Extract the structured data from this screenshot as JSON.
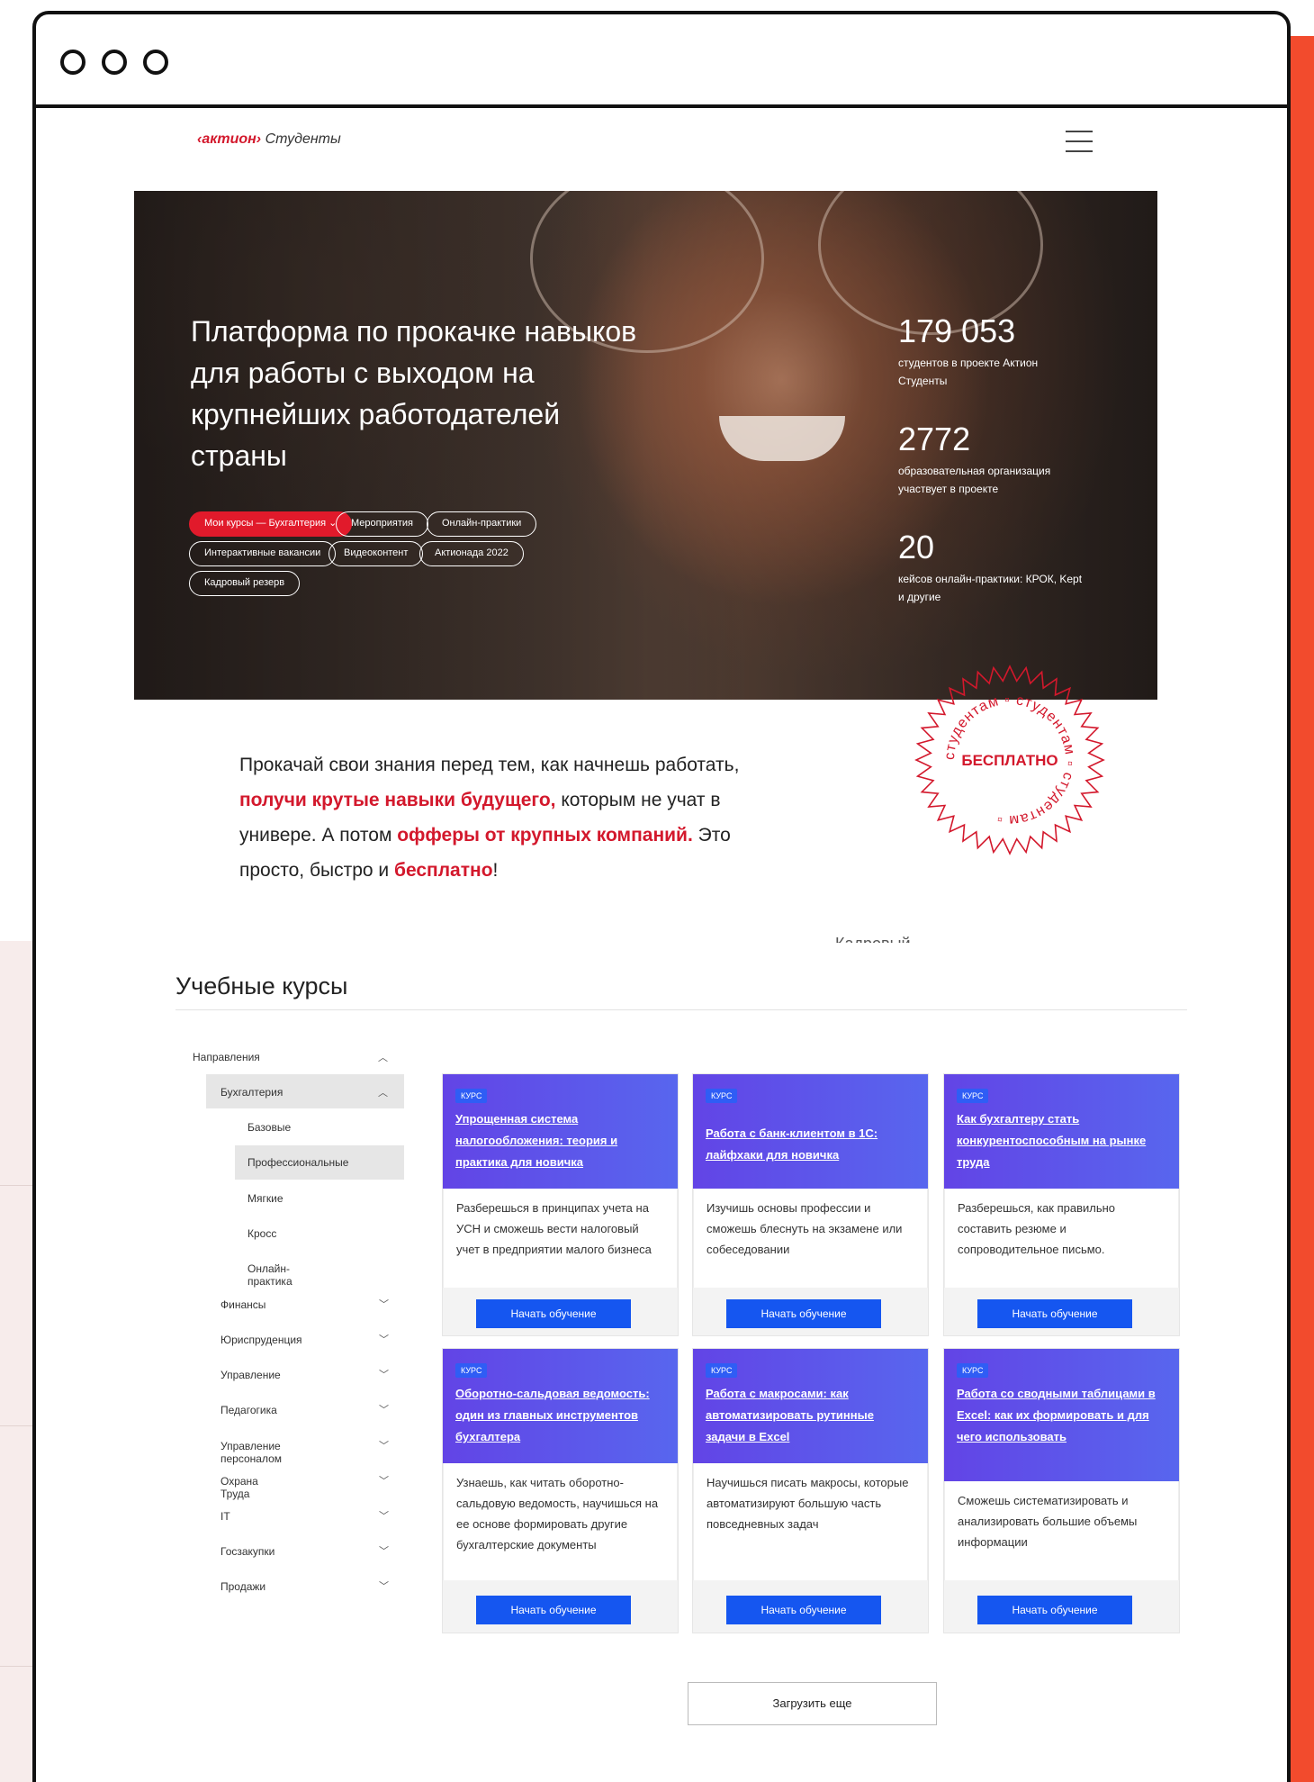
{
  "header": {
    "brand": "‹актион›",
    "brand_sub": "Студенты"
  },
  "hero": {
    "title": "Платформа по прокачке навыков для работы с выходом на крупнейших работодателей страны",
    "pills": [
      {
        "label": "Мои курсы — Бухгалтерия ⌄",
        "active": true
      },
      {
        "label": "Мероприятия",
        "active": false
      },
      {
        "label": "Онлайн-практики",
        "active": false
      },
      {
        "label": "Интерактивные вакансии",
        "active": false
      },
      {
        "label": "Видеоконтент",
        "active": false
      },
      {
        "label": "Актионада 2022",
        "active": false
      },
      {
        "label": "Кадровый резерв",
        "active": false
      }
    ],
    "stats": [
      {
        "number": "179 053",
        "label": "студентов в проекте Актион Студенты"
      },
      {
        "number": "2772",
        "label": "образовательная организация участвует в проекте"
      },
      {
        "number": "20",
        "label": "кейсов онлайн-практики: КРОК, Kept и другие"
      }
    ]
  },
  "intro": {
    "p1": "Прокачай свои знания перед тем, как начнешь работать, ",
    "b1": "получи крутые навыки будущего,",
    "p2": " которым не учат в универе. А потом ",
    "b2": "офферы от крупных компаний.",
    "p3": " Это просто, быстро и ",
    "b3": "бесплатно",
    "p4": "!"
  },
  "stamp": {
    "center": "БЕСПЛАТНО",
    "ring": "студентам ▫ студентам ▫ студентам ▫ "
  },
  "clipped_label": "Кадровый",
  "courses": {
    "title": "Учебные курсы",
    "sidebar": {
      "root": "Направления",
      "open_group": "Бухгалтерия",
      "sub_items": [
        "Базовые",
        "Профессиональные",
        "Мягкие",
        "Кросс",
        "Онлайн-практика"
      ],
      "groups": [
        "Финансы",
        "Юриспруденция",
        "Управление",
        "Педагогика",
        "Управление персоналом",
        "Охрана Труда",
        "IT",
        "Госзакупки",
        "Продажи"
      ]
    },
    "cards": [
      {
        "badge": "КУРС",
        "title": "Упрощенная система налогообложения: теория и практика для новичка",
        "desc": "Разберешься в принципах учета на УСН и сможешь вести налоговый учет в предприятии малого бизнеса",
        "button": "Начать обучение"
      },
      {
        "badge": "КУРС",
        "title": "Работа с банк-клиентом в 1С: лайфхаки для новичка",
        "desc": "Изучишь основы профессии и сможешь блеснуть на экзамене или собеседовании",
        "button": "Начать обучение"
      },
      {
        "badge": "КУРС",
        "title": "Как бухгалтеру стать конкурентоспособным на рынке труда",
        "desc": "Разберешься, как правильно составить резюме и сопроводительное письмо.",
        "button": "Начать обучение"
      },
      {
        "badge": "КУРС",
        "title": "Оборотно-сальдовая ведомость: один из главных инструментов бухгалтера",
        "desc": "Узнаешь, как читать оборотно-сальдовую ведомость, научишься на ее основе формировать другие бухгалтерские документы",
        "button": "Начать обучение"
      },
      {
        "badge": "КУРС",
        "title": "Работа с макросами: как автоматизировать рутинные задачи в Excel",
        "desc": "Научишься писать макросы, которые автоматизируют большую часть повседневных задач",
        "button": "Начать обучение"
      },
      {
        "badge": "КУРС",
        "title": "Работа со сводными таблицами в Excel: как их формировать и для чего использовать",
        "desc": "Сможешь систематизировать и анализировать большие объемы информации",
        "button": "Начать обучение"
      }
    ],
    "load_more": "Загрузить еще"
  },
  "colors": {
    "accent_red": "#d3182c",
    "button_blue": "#1556f0",
    "card_head": "#5a55ea",
    "frame_red": "#f24b2d"
  },
  "icons": [
    "burger-menu-icon",
    "chevron-up-icon",
    "chevron-down-icon"
  ]
}
